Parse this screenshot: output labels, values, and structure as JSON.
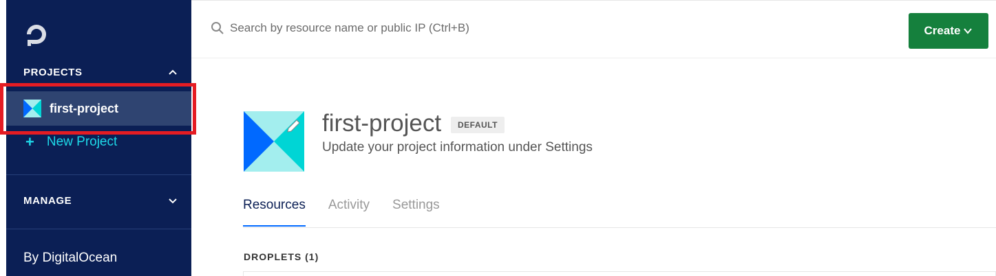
{
  "sidebar": {
    "projects_heading": "PROJECTS",
    "project_name": "first-project",
    "new_project_plus": "+",
    "new_project_label": "New Project",
    "manage_heading": "MANAGE",
    "footer": "By DigitalOcean"
  },
  "topbar": {
    "search_placeholder": "Search by resource name or public IP (Ctrl+B)",
    "create_label": "Create"
  },
  "project": {
    "title": "first-project",
    "badge": "DEFAULT",
    "subtitle": "Update your project information under Settings"
  },
  "tabs": [
    {
      "label": "Resources",
      "active": true
    },
    {
      "label": "Activity",
      "active": false
    },
    {
      "label": "Settings",
      "active": false
    }
  ],
  "section": {
    "droplets_heading": "DROPLETS (1)"
  },
  "colors": {
    "sidebar_bg": "#0b1f55",
    "accent_green": "#15803d",
    "accent_cyan": "#1ed8e8",
    "highlight_red": "#e51c23"
  },
  "icons": [
    "digitalocean-logo-icon",
    "chevron-up-icon",
    "chevron-down-icon",
    "project-icon",
    "search-icon",
    "pencil-icon"
  ]
}
